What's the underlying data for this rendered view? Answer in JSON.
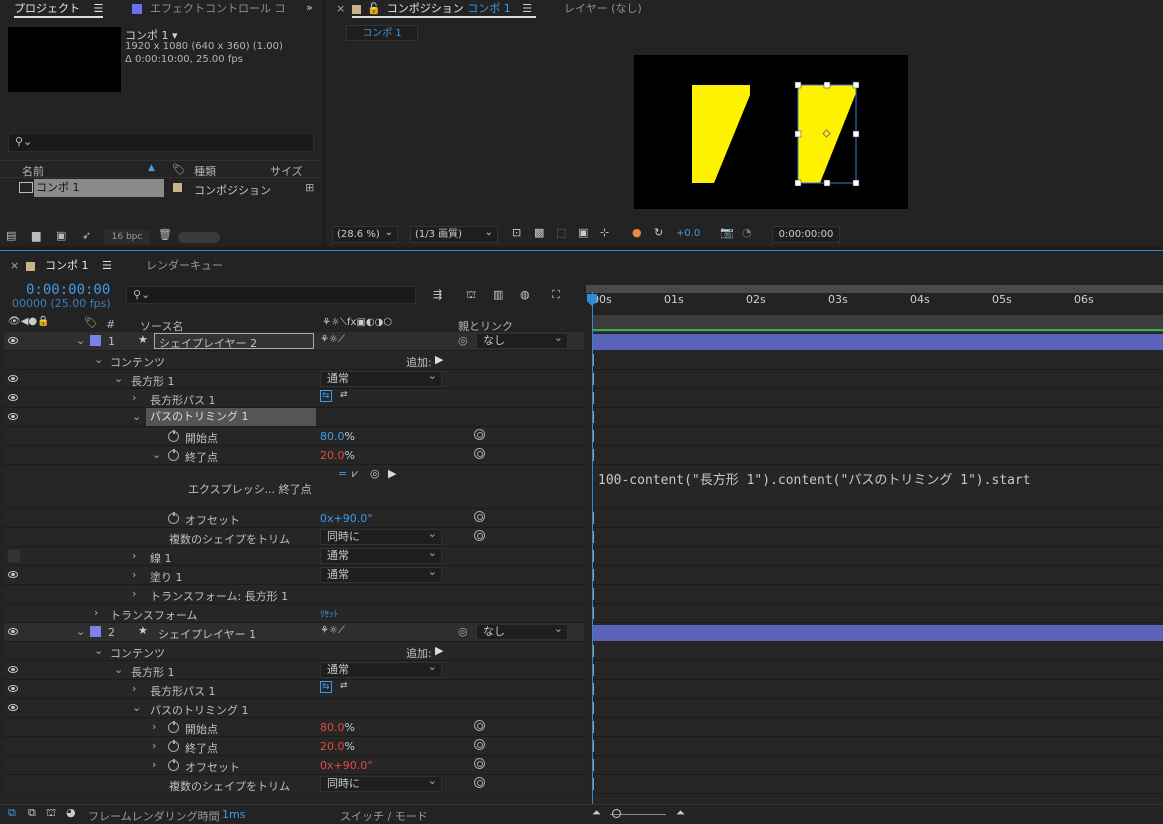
{
  "project_panel": {
    "tab_project": "プロジェクト",
    "tab_effect": "エフェクトコントロール コ",
    "comp_name": "コンポ 1 ▾",
    "comp_size": "1920 x 1080  (640 x 360) (1.00)",
    "comp_dur": "Δ 0:00:10:00, 25.00 fps",
    "search_placeholder": "",
    "col_name": "名前",
    "col_type": "種類",
    "col_size": "サイズ",
    "item_name": "コンポ 1",
    "item_type": "コンポジション",
    "bpc": "16 bpc"
  },
  "comp_panel": {
    "tab_comp_prefix": "コンポジション",
    "tab_comp_name": "コンポ 1",
    "tab_layer": "レイヤー (なし)",
    "sub_tab": "コンポ 1",
    "zoom": "(28.6 %)",
    "resolution": "(1/3 画質)",
    "exposure": "+0.0",
    "timecode": "0:00:00:00"
  },
  "timeline": {
    "tab_comp": "コンポ 1",
    "tab_render": "レンダーキュー",
    "timecode": "0:00:00:00",
    "frames": "00000 (25.00 fps)",
    "col_source": "ソース名",
    "col_parent": "親とリンク",
    "col_hash": "#",
    "ruler": [
      "00s",
      "01s",
      "02s",
      "03s",
      "04s",
      "05s",
      "06s"
    ],
    "layer1": {
      "num": "1",
      "name": "シェイプレイヤー 2",
      "parent": "なし"
    },
    "layer2": {
      "num": "2",
      "name": "シェイプレイヤー 1",
      "parent": "なし"
    },
    "contents": "コンテンツ",
    "add": "追加:",
    "rect": "長方形 1",
    "rect_path": "長方形パス 1",
    "trim": "パスのトリミング 1",
    "start": "開始点",
    "end": "終了点",
    "offset": "オフセット",
    "multi": "複数のシェイプをトリム",
    "stroke": "線 1",
    "fill": "塗り 1",
    "transform_rect": "トランスフォーム: 長方形 1",
    "transform": "トランスフォーム",
    "reset": "ﾘｾｯﾄ",
    "normal": "通常",
    "simultaneous": "同時に",
    "l1_start": "80.0",
    "l1_end": "20.0",
    "l1_offset": "0x+90.0°",
    "l2_start": "80.0",
    "l2_end": "20.0",
    "l2_offset": "0x+90.0°",
    "pct": "%",
    "expr_label": "エクスプレッシ... 終了点",
    "expression": "100-content(\"長方形 1\").content(\"パスのトリミング 1\").start",
    "status_render": "フレームレンダリング時間",
    "status_ms": "1ms",
    "status_switch": "スイッチ / モード"
  },
  "colors": {
    "accent": "#2f8bd6",
    "yellow": "#fff200",
    "layer_bar": "#5a63b8",
    "red_value": "#e24a3f"
  }
}
